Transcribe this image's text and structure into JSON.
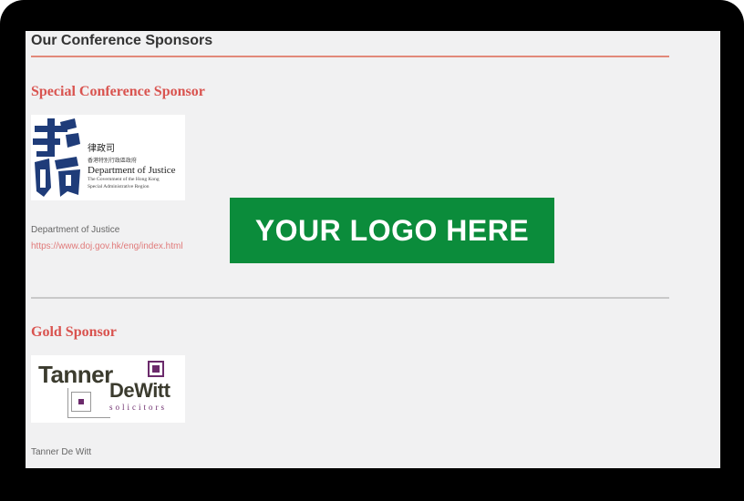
{
  "page": {
    "title": "Our Conference Sponsors"
  },
  "sections": [
    {
      "title": "Special Conference Sponsor",
      "sponsor_name": "Department of Justice",
      "sponsor_url": "https://www.doj.gov.hk/eng/index.html",
      "logo": {
        "zh_title": "律政司",
        "zh_subtitle": "香港特別行政區政府",
        "en_title": "Department of Justice",
        "en_gov_line1": "The Government of the Hong Kong",
        "en_gov_line2": "Special Administrative Region"
      }
    },
    {
      "title": "Gold Sponsor",
      "sponsor_name": "Tanner De Witt",
      "logo": {
        "word1": "Tanner",
        "word2": "DeWitt",
        "subtitle": "solicitors"
      }
    }
  ],
  "banner": {
    "text": "YOUR LOGO HERE",
    "color": "#0b8c3b"
  },
  "colors": {
    "accent": "#d9534f",
    "rule": "#e2897a",
    "link": "#e07a7a"
  }
}
